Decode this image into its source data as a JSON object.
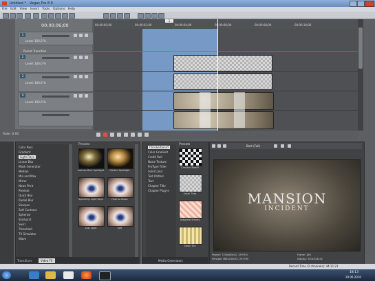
{
  "app": {
    "title": "Untitled * - Vegas Pro 8.0"
  },
  "menu": [
    "File",
    "Edit",
    "View",
    "Insert",
    "Tools",
    "Options",
    "Help"
  ],
  "timeline": {
    "timecode": "00:00:06;00",
    "ruler_ticks": [
      "00:00:00;00",
      "00:00:02;00",
      "00:00:04;00",
      "00:00:06;00",
      "00:00:08;00",
      "00:00:10;00"
    ],
    "region_marker": "1",
    "rate": "Rate: 0.00"
  },
  "tracks": [
    {
      "num": "1",
      "level": "Level: 100.0 %"
    },
    {
      "num": "2",
      "level": "Level: 100.0 %"
    },
    {
      "num": "3",
      "level": "Level: 100.0 %"
    },
    {
      "num": "4",
      "level": "Level: 100.0 %"
    }
  ],
  "parent_label": "Parent Transition",
  "effects": {
    "tree": [
      "Color Pass",
      "Gradient",
      "Light Rays",
      "Linear Blur",
      "Mask Generator",
      "Median",
      "Min and Max",
      "Mirror",
      "News Print",
      "Pixelate",
      "Quick Blur",
      "Radial Blur",
      "Sharpen",
      "Soft Contrast",
      "Spherize",
      "Starburst",
      "Swirl",
      "Threshold",
      "TV Simulator",
      "Wave"
    ],
    "selected": "Light Rays",
    "presets_header": "Presets",
    "presets": [
      "Intense Blue Spotlight",
      "Golden Spotlight",
      "Sparkling Light Rays",
      "Fade to Black",
      "Low Light",
      "Soft"
    ],
    "tabs": [
      "Transitions",
      "Video FX"
    ]
  },
  "media": {
    "list": [
      "Checkerboard",
      "Color Gradient",
      "Credit Roll",
      "Noise Texture",
      "ProType Titler",
      "Solid Color",
      "Test Pattern",
      "Text",
      "Chapter Title",
      "Chapter Plug-In"
    ],
    "selected": "Checkerboard",
    "presets_header": "Presets",
    "presets": [
      "Checker Board",
      "Small Tiles",
      "Diagonal Stripes",
      "Small Tile"
    ],
    "tab": "Media Generators"
  },
  "preview": {
    "title_line1": "MANSION",
    "title_line2": "INCIDENT",
    "quality": "Best (Full)",
    "project": "Project: 720x480x32, 29.970i",
    "preview_res": "Preview: 360x240x32, 29.970i",
    "frame": "Frame: 180",
    "display": "Display: 320x214x32"
  },
  "statusbar": {
    "record": "Record Time (2 channels): 44:11:21"
  },
  "taskbar": {
    "time": "18:13",
    "date": "20.06.2010"
  },
  "colors": {
    "loop_region": "#7ea6d9",
    "accent": "#35596f"
  }
}
